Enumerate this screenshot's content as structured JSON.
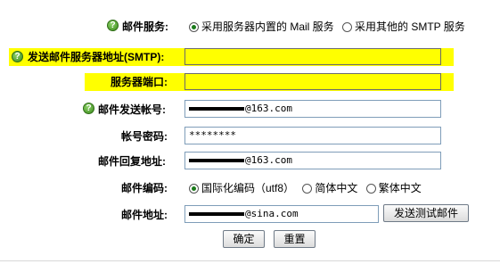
{
  "mail_service": {
    "label": "邮件服务:",
    "options": [
      "采用服务器内置的 Mail 服务",
      "采用其他的 SMTP 服务"
    ],
    "selected": 0
  },
  "smtp_server": {
    "label": "发送邮件服务器地址(SMTP):",
    "value": ""
  },
  "smtp_port": {
    "label": "服务器端口:",
    "value": ""
  },
  "send_account": {
    "label": "邮件发送帐号:",
    "value": "@163.com"
  },
  "account_password": {
    "label": "帐号密码:",
    "value": "********"
  },
  "reply_address": {
    "label": "邮件回复地址:",
    "value": "@163.com"
  },
  "encoding": {
    "label": "邮件编码:",
    "options": [
      "国际化编码（utf8）",
      "简体中文",
      "繁体中文"
    ],
    "selected": 0
  },
  "mail_address": {
    "label": "邮件地址:",
    "value": "@sina.com"
  },
  "buttons": {
    "send_test": "发送测试邮件",
    "ok": "确定",
    "reset": "重置"
  },
  "colors": {
    "highlight": "#ffff00",
    "help_icon": "#3a8a1c"
  }
}
